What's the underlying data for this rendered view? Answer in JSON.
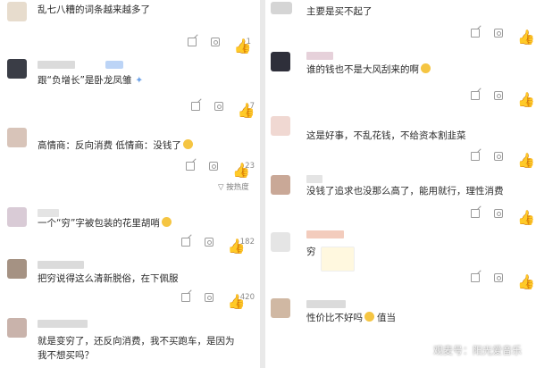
{
  "left_comments": [
    {
      "text": "乱七八糟的词条越来越多了",
      "likes": "1"
    },
    {
      "text": "跟“负增长”是卧龙凤雏",
      "likes": "7"
    },
    {
      "text": "高情商：反向消费 低情商：没钱了",
      "likes": "23",
      "reply_label": "按热度"
    },
    {
      "text": "一个“穷”字被包装的花里胡哨",
      "likes": "182"
    },
    {
      "text": "把穷说得这么清新脱俗，在下佩服",
      "likes": "420"
    },
    {
      "text_line1": "就是变穷了，还反向消费，我不买跑车，是因为",
      "text_line2": "我不想买吗？"
    }
  ],
  "right_comments": [
    {
      "text": "主要是买不起了"
    },
    {
      "text": "谁的钱也不是大风刮来的啊"
    },
    {
      "text": "这是好事，不乱花钱，不给资本割韭菜"
    },
    {
      "text": "没钱了追求也没那么高了，能用就行，理性消费"
    },
    {
      "text": "穷"
    },
    {
      "text": "性价比不好吗",
      "text_suffix": "值当"
    }
  ],
  "watermark": "观麦号：阳光爱音乐"
}
